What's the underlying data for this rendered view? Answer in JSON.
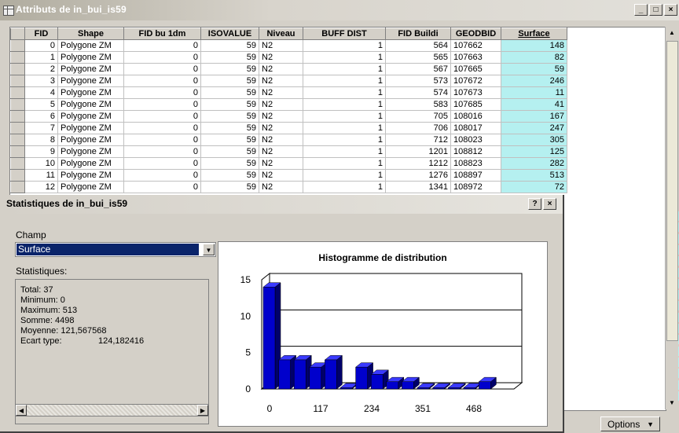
{
  "window": {
    "title": "Attributs de in_bui_is59",
    "buttons": [
      "_",
      "□",
      "×"
    ]
  },
  "table": {
    "columns": [
      "FID",
      "Shape",
      "FID bu 1dm",
      "ISOVALUE",
      "Niveau",
      "BUFF DIST",
      "FID Buildi",
      "GEODBID",
      "Surface"
    ],
    "rows": [
      [
        "0",
        "Polygone ZM",
        "0",
        "59",
        "N2",
        "1",
        "564",
        "107662",
        "148"
      ],
      [
        "1",
        "Polygone ZM",
        "0",
        "59",
        "N2",
        "1",
        "565",
        "107663",
        "82"
      ],
      [
        "2",
        "Polygone ZM",
        "0",
        "59",
        "N2",
        "1",
        "567",
        "107665",
        "59"
      ],
      [
        "3",
        "Polygone ZM",
        "0",
        "59",
        "N2",
        "1",
        "573",
        "107672",
        "246"
      ],
      [
        "4",
        "Polygone ZM",
        "0",
        "59",
        "N2",
        "1",
        "574",
        "107673",
        "11"
      ],
      [
        "5",
        "Polygone ZM",
        "0",
        "59",
        "N2",
        "1",
        "583",
        "107685",
        "41"
      ],
      [
        "6",
        "Polygone ZM",
        "0",
        "59",
        "N2",
        "1",
        "705",
        "108016",
        "167"
      ],
      [
        "7",
        "Polygone ZM",
        "0",
        "59",
        "N2",
        "1",
        "706",
        "108017",
        "247"
      ],
      [
        "8",
        "Polygone ZM",
        "0",
        "59",
        "N2",
        "1",
        "712",
        "108023",
        "305"
      ],
      [
        "9",
        "Polygone ZM",
        "0",
        "59",
        "N2",
        "1",
        "1201",
        "108812",
        "125"
      ],
      [
        "10",
        "Polygone ZM",
        "0",
        "59",
        "N2",
        "1",
        "1212",
        "108823",
        "282"
      ],
      [
        "11",
        "Polygone ZM",
        "0",
        "59",
        "N2",
        "1",
        "1276",
        "108897",
        "513"
      ],
      [
        "12",
        "Polygone ZM",
        "0",
        "59",
        "N2",
        "1",
        "1341",
        "108972",
        "72"
      ]
    ],
    "surface_fragments": [
      "3",
      "9",
      "7",
      "1",
      "2",
      "9",
      "6",
      "9",
      "5",
      "3",
      "1",
      "3",
      "8",
      "1",
      "4",
      "0",
      "8"
    ]
  },
  "options_button": "Options",
  "dialog": {
    "title": "Statistiques de in_bui_is59",
    "buttons": [
      "?",
      "×"
    ],
    "champ_label": "Champ",
    "champ_value": "Surface",
    "stats_label": "Statistiques:",
    "stats": {
      "total": "Total:     37",
      "minimum": "Minimum:  0",
      "maximum": "Maximum: 513",
      "somme": "Somme:   4498",
      "moyenne": "Moyenne: 121,567568",
      "ecart": "Ecart type:",
      "ecart_value": "124,182416"
    }
  },
  "chart_data": {
    "type": "bar",
    "title": "Histogramme de distribution",
    "x_tick_labels": [
      "0",
      "117",
      "234",
      "351",
      "468"
    ],
    "y_tick_labels": [
      "0",
      "5",
      "10",
      "15"
    ],
    "ylim": [
      0,
      15
    ],
    "values": [
      14,
      4,
      4,
      3,
      4,
      0,
      3,
      2,
      1,
      1,
      0,
      0,
      0,
      0,
      1
    ],
    "colors": {
      "bar": "#0000cc",
      "bar_side": "#00006a",
      "bar_top": "#3a3aff"
    }
  }
}
